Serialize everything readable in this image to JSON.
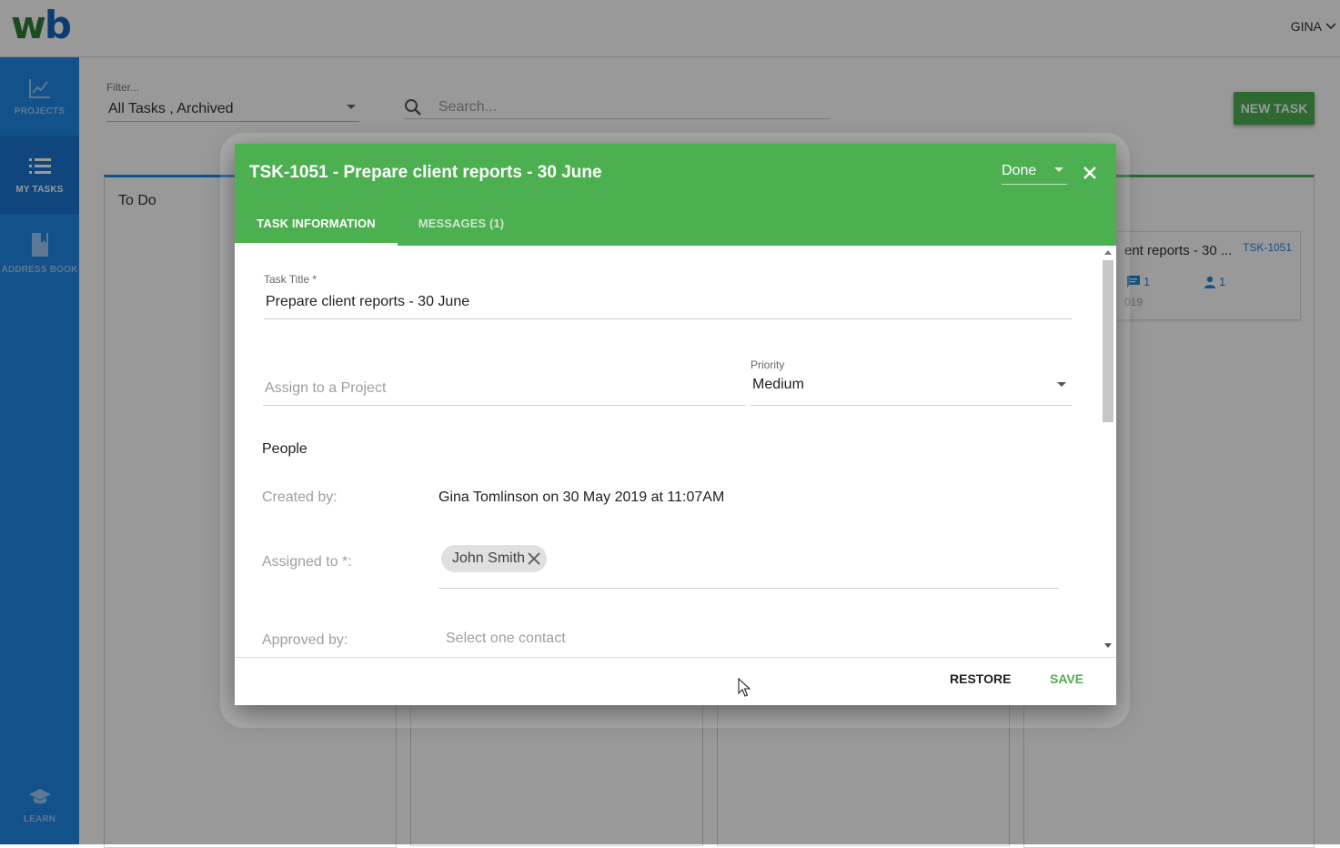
{
  "brand": {
    "logo_w": "w",
    "logo_b": "b"
  },
  "header": {
    "user_name": "GINA"
  },
  "sidebar": {
    "items": [
      {
        "label": "PROJECTS",
        "icon": "chart-line-icon"
      },
      {
        "label": "MY TASKS",
        "icon": "list-icon"
      },
      {
        "label": "ADDRESS BOOK",
        "icon": "book-icon"
      },
      {
        "label": "LEARN",
        "icon": "graduation-cap-icon"
      }
    ]
  },
  "toolbar": {
    "filter_label": "Filter...",
    "filter_value": "All Tasks , Archived",
    "search_placeholder": "Search...",
    "new_task_label": "NEW TASK"
  },
  "board": {
    "columns": [
      {
        "title": "To Do"
      }
    ],
    "card": {
      "title": "ent reports - 30 ...",
      "id": "TSK-1051",
      "messages_count": "1",
      "people_count": "1",
      "date_fragment": "019"
    }
  },
  "modal": {
    "title": "TSK-1051 - Prepare client reports - 30 June",
    "status": "Done",
    "tabs": [
      {
        "label": "TASK INFORMATION",
        "active": true
      },
      {
        "label": "MESSAGES (1)",
        "active": false
      }
    ],
    "task_title_label": "Task Title *",
    "task_title_value": "Prepare client reports - 30 June",
    "project_placeholder": "Assign to a Project",
    "priority_label": "Priority",
    "priority_value": "Medium",
    "people_section": "People",
    "created_by_label": "Created by:",
    "created_by_value": "Gina Tomlinson on 30 May 2019 at 11:07AM",
    "assigned_to_label": "Assigned to *:",
    "assigned_chip": "John Smith",
    "approved_by_label": "Approved by:",
    "approved_by_placeholder": "Select one contact",
    "restore_label": "RESTORE",
    "save_label": "SAVE"
  },
  "colors": {
    "sidebar": "#1e88e5",
    "header_green": "#4caf50",
    "accent_blue": "#1e88e5"
  }
}
